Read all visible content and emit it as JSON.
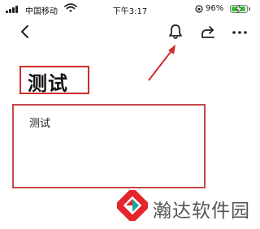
{
  "status_bar": {
    "carrier": "中国移动",
    "time": "下午3:17",
    "battery_percent": "96%",
    "battery_level": 0.96,
    "battery_color": "#3cc13b",
    "icons": [
      "signal-icon",
      "wifi-icon",
      "orientation-lock-icon",
      "battery-icon",
      "charging-bolt-icon"
    ]
  },
  "toolbar": {
    "icons": [
      "back-chevron-icon",
      "bell-icon",
      "share-icon",
      "more-icon"
    ]
  },
  "note": {
    "title": "测试",
    "body": "测试"
  },
  "annotation": {
    "color": "#d22b2b"
  },
  "watermark": {
    "text": "瀚达软件园",
    "logo_colors": [
      "#e2262b",
      "#1aa89a"
    ]
  }
}
